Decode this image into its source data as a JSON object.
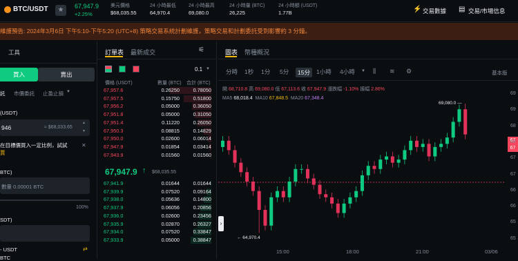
{
  "header": {
    "pair": "BTC/USDT",
    "price": "67,947.9",
    "change": "+2.25%",
    "stats": [
      {
        "label": "美元價格",
        "value": "$68,035.55"
      },
      {
        "label": "24 小時最低",
        "value": "64,970.4"
      },
      {
        "label": "24 小時最高",
        "value": "69,080.0"
      },
      {
        "label": "24 小時量 (BTC)",
        "value": "26,225"
      },
      {
        "label": "24 小時額 (USDT)",
        "value": "1.77B"
      }
    ],
    "data_link": "交易數據",
    "info_link": "交易/市場信息"
  },
  "banner": "維護預告: 2024年3月6日 下午5:10-下午5:20 (UTC+8) 策略交易系統計劃維護，策略交易和計劃委託受到影響約 3 分鐘。",
  "left": {
    "tools": "工具",
    "buy": "買入",
    "sell": "賣出",
    "order_types": [
      "託",
      "市價委託",
      "止盈止損"
    ],
    "price_label": "(USDT)",
    "price_value": "946",
    "price_approx": "≈ $68,033.65",
    "note": "在目標價買入一定比例，試試",
    "note2": "賈",
    "amount_label": "BTC)",
    "amount_placeholder": "數量 0.00001 BTC",
    "percent": "100%",
    "total_label": "SDT)",
    "bottom1": "- USDT",
    "bottom2": "BTC"
  },
  "book": {
    "tab_book": "訂單表",
    "tab_trades": "最新成交",
    "step": "0.1",
    "cols": [
      "價格 (USDT)",
      "數量 (BTC)",
      "合計 (BTC)"
    ],
    "asks": [
      [
        "67,957.6",
        "0.26250",
        "0.78050"
      ],
      [
        "67,957.5",
        "0.15750",
        "0.51800"
      ],
      [
        "67,956.2",
        "0.05000",
        "0.36050"
      ],
      [
        "67,951.8",
        "0.05000",
        "0.31050"
      ],
      [
        "67,951.4",
        "0.11220",
        "0.26050"
      ],
      [
        "67,950.3",
        "0.08815",
        "0.14829"
      ],
      [
        "67,950.0",
        "0.02600",
        "0.06014"
      ],
      [
        "67,947.9",
        "0.01854",
        "0.03414"
      ],
      [
        "67,943.9",
        "0.01560",
        "0.01560"
      ]
    ],
    "last_price": "67,947.9",
    "last_usd": "$68,035.55",
    "bids": [
      [
        "67,941.9",
        "0.01644",
        "0.01644"
      ],
      [
        "67,939.9",
        "0.07520",
        "0.09164"
      ],
      [
        "67,938.0",
        "0.05636",
        "0.14800"
      ],
      [
        "67,937.9",
        "0.06056",
        "0.20856"
      ],
      [
        "67,936.0",
        "0.02600",
        "0.23456"
      ],
      [
        "67,935.9",
        "0.02870",
        "0.26327"
      ],
      [
        "67,934.0",
        "0.07520",
        "0.33847"
      ],
      [
        "67,933.9",
        "0.05000",
        "0.38847"
      ]
    ]
  },
  "chart": {
    "tab_chart": "圖表",
    "tab_overview": "幣種概況",
    "intervals": [
      "分時",
      "1秒",
      "1分",
      "5分",
      "15分",
      "1小時",
      "4小時"
    ],
    "active_interval": "15分",
    "style": "基本版",
    "ohlc": {
      "o_l": "開",
      "o": "68,710.8",
      "h_l": "高",
      "h": "69,080.0",
      "lo_l": "低",
      "lo": "67,113.6",
      "c_l": "收",
      "c": "67,947.9",
      "chg_l": "漲跌幅",
      "chg": "-1.10%",
      "amp_l": "振幅",
      "amp": "2.86%"
    },
    "ma": [
      {
        "name": "MA5",
        "value": "68,018.4",
        "color": "#eaecef"
      },
      {
        "name": "MA10",
        "value": "67,848.5",
        "color": "#f0b90b"
      },
      {
        "name": "MA20",
        "value": "67,348.4",
        "color": "#c27ff2"
      }
    ],
    "high_marker": "69,080.0 —",
    "low_marker": "← 64,970.4",
    "times": [
      "15:00",
      "18:00",
      "21:00",
      "03/06"
    ],
    "yticks": [
      "69",
      "69",
      "68",
      "68",
      "67",
      "67",
      "66",
      "66",
      "65",
      "65"
    ],
    "ybadge": "67"
  }
}
